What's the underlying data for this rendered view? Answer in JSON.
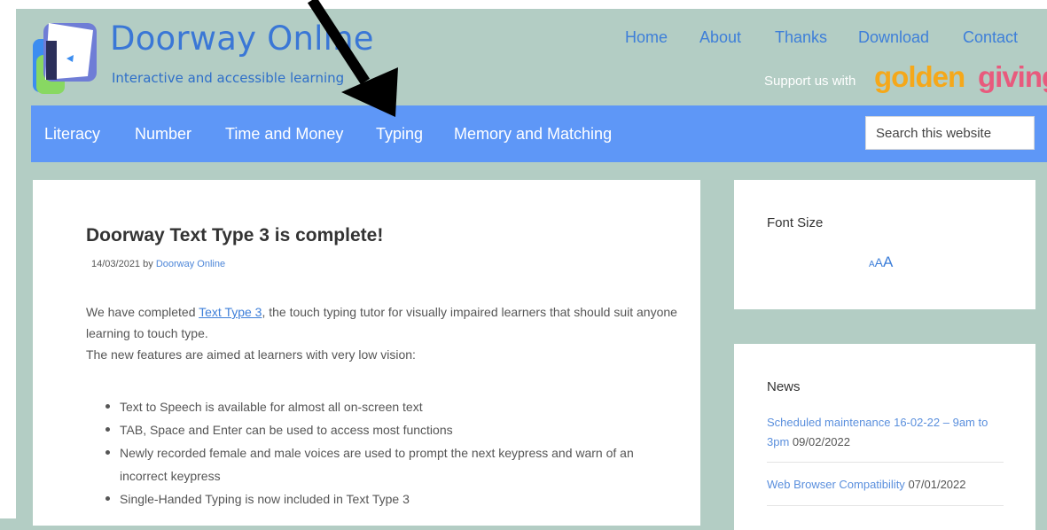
{
  "site": {
    "title": "Doorway Online",
    "tagline": "Interactive and accessible learning"
  },
  "top_nav": [
    "Home",
    "About",
    "Thanks",
    "Download",
    "Contact"
  ],
  "support": {
    "text": "Support us with",
    "brand_part1": "golden",
    "brand_part2": "giving"
  },
  "main_nav": [
    "Literacy",
    "Number",
    "Time and Money",
    "Typing",
    "Memory and Matching"
  ],
  "search": {
    "placeholder": "Search this website"
  },
  "post": {
    "title": "Doorway Text Type 3 is complete!",
    "date": "14/03/2021",
    "by": "by",
    "author": "Doorway Online",
    "intro_before_link": "We have completed ",
    "intro_link": "Text Type 3",
    "intro_after_link": ", the touch typing tutor for visually impaired learners that should suit anyone learning to touch type.",
    "features_intro": "The new features are aimed at learners with very low vision:",
    "features": [
      "Text to Speech is available for almost all on-screen text",
      "TAB, Space and Enter can be used to access most functions",
      "Newly recorded female and male voices are used to prompt the next keypress and warn of an incorrect keypress",
      "Single-Handed Typing is now included in Text Type 3"
    ]
  },
  "sidebar": {
    "font_size": {
      "title": "Font Size",
      "small": "A",
      "medium": "A",
      "large": "A"
    },
    "news": {
      "title": "News",
      "items": [
        {
          "link": "Scheduled maintenance 16-02-22 – 9am to 3pm",
          "date": "09/02/2022"
        },
        {
          "link": "Web Browser Compatibility",
          "date": "07/01/2022"
        }
      ]
    }
  },
  "colors": {
    "background": "#b3cdc4",
    "navbar": "#5e97f7",
    "link": "#3e7fd9",
    "golden": "#f5a81a",
    "giving": "#e85a7d"
  },
  "icons": {
    "logo": "doorway-logo",
    "annotation": "arrow-down-icon"
  }
}
